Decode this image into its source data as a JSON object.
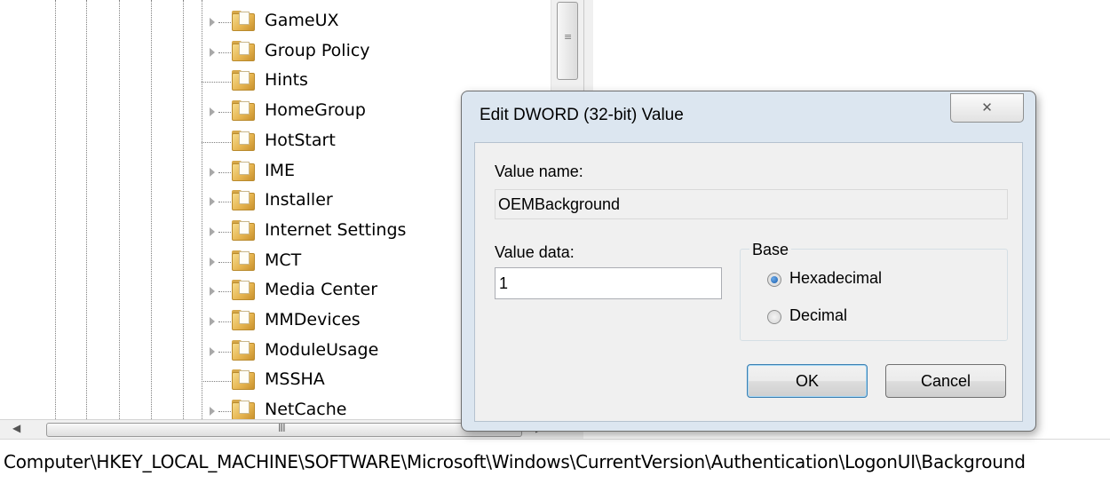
{
  "tree": {
    "items": [
      {
        "label": "GameUX",
        "expandable": true
      },
      {
        "label": "Group Policy",
        "expandable": true
      },
      {
        "label": "Hints",
        "expandable": false
      },
      {
        "label": "HomeGroup",
        "expandable": true
      },
      {
        "label": "HotStart",
        "expandable": false
      },
      {
        "label": "IME",
        "expandable": true
      },
      {
        "label": "Installer",
        "expandable": true
      },
      {
        "label": "Internet Settings",
        "expandable": true
      },
      {
        "label": "MCT",
        "expandable": true
      },
      {
        "label": "Media Center",
        "expandable": true
      },
      {
        "label": "MMDevices",
        "expandable": true
      },
      {
        "label": "ModuleUsage",
        "expandable": true
      },
      {
        "label": "MSSHA",
        "expandable": false
      },
      {
        "label": "NetCache",
        "expandable": true
      }
    ]
  },
  "scrollbar": {
    "grip": "≡",
    "hgrip": "III",
    "left_arrow": "◀",
    "right_arrow": "▶"
  },
  "dialog": {
    "title": "Edit DWORD (32-bit) Value",
    "close_glyph": "✕",
    "value_name_label": "Value name:",
    "value_name": "OEMBackground",
    "value_data_label": "Value data:",
    "value_data": "1",
    "base_label": "Base",
    "hex_label": "Hexadecimal",
    "dec_label": "Decimal",
    "base_selected": "Hexadecimal",
    "ok_label": "OK",
    "cancel_label": "Cancel"
  },
  "statusbar": {
    "path": "Computer\\HKEY_LOCAL_MACHINE\\SOFTWARE\\Microsoft\\Windows\\CurrentVersion\\Authentication\\LogonUI\\Background"
  }
}
